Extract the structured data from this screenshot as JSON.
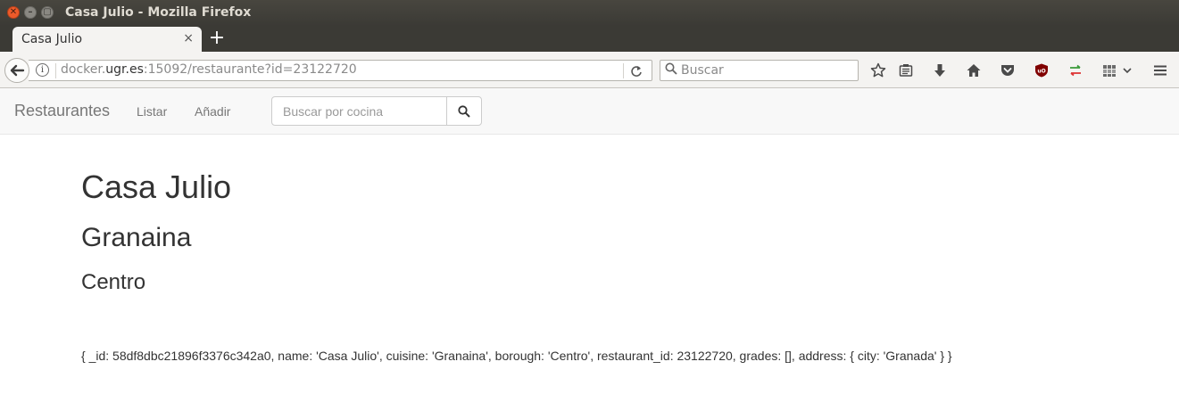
{
  "window": {
    "title": "Casa Julio - Mozilla Firefox"
  },
  "tab": {
    "label": "Casa Julio",
    "close": "×",
    "new_tab": "+"
  },
  "url": {
    "prefix": "docker.",
    "domain": "ugr.es",
    "suffix": ":15092/restaurante?id=23122720"
  },
  "browser_search": {
    "placeholder": "Buscar"
  },
  "toolbar_icons": [
    "bookmark-star-icon",
    "reading-list-icon",
    "download-icon",
    "home-icon",
    "pocket-icon",
    "ublock-icon",
    "sync-arrows-icon",
    "extensions-icon",
    "menu-icon"
  ],
  "site_nav": {
    "brand": "Restaurantes",
    "links": [
      "Listar",
      "Añadir"
    ],
    "search_placeholder": "Buscar por cocina"
  },
  "restaurant": {
    "name": "Casa Julio",
    "cuisine": "Granaina",
    "borough": "Centro",
    "raw": "{ _id: 58df8dbc21896f3376c342a0, name: 'Casa Julio', cuisine: 'Granaina', borough: 'Centro', restaurant_id: 23122720, grades: [], address: { city: 'Granada' } }"
  },
  "colors": {
    "titlebar": "#3b3a35",
    "close_button": "#ed5a2a",
    "nav_bg": "#f8f8f8"
  }
}
